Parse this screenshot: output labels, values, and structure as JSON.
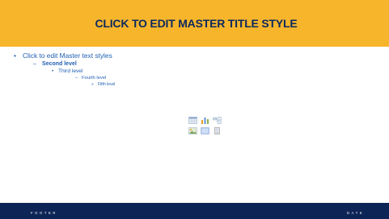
{
  "colors": {
    "title_band": "#f7b52c",
    "title_text": "#0c2a5c",
    "body_text": "#1f5fb3",
    "footer_band": "#0d2456",
    "footer_text": "#ffffff"
  },
  "title": {
    "text": "CLICK TO EDIT MASTER TITLE STYLE"
  },
  "body": {
    "bullets": {
      "level1": "•",
      "level2": "–",
      "level3": "•",
      "level4": "–",
      "level5": "»"
    },
    "levels": {
      "level1": "Click to edit Master text styles",
      "level2": "Second level",
      "level3": "Third level",
      "level4": "Fourth level",
      "level5": "Fifth level"
    }
  },
  "content_placeholder": {
    "icons": [
      "table-icon",
      "chart-icon",
      "smartart-icon",
      "picture-icon",
      "online-picture-icon",
      "video-icon"
    ]
  },
  "footer": {
    "left": "FOOTER",
    "right": "DATE"
  }
}
